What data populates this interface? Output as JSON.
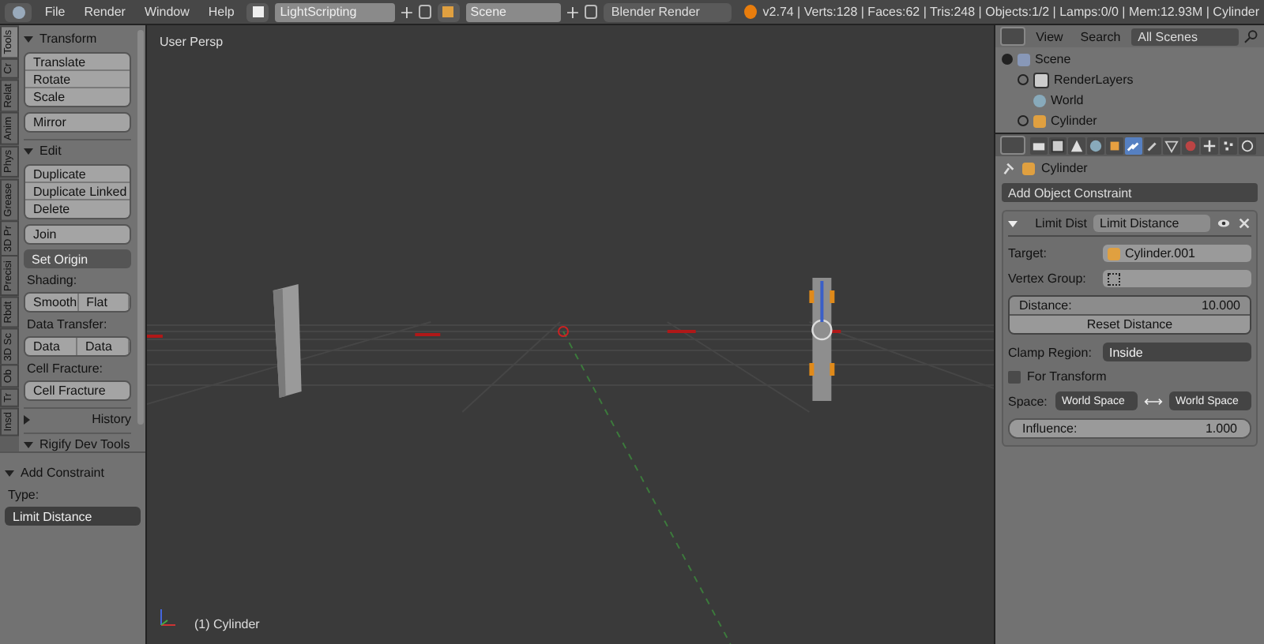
{
  "top_bar": {
    "menus": [
      "File",
      "Render",
      "Window",
      "Help"
    ],
    "layout": "LightScripting",
    "scene": "Scene",
    "engine": "Blender Render",
    "stats": "v2.74 | Verts:128 | Faces:62 | Tris:248 | Objects:1/2 | Lamps:0/0 | Mem:12.93M | Cylinder"
  },
  "tool_tabs": [
    {
      "label": "Tools",
      "selected": true
    },
    {
      "label": "Cr",
      "selected": false
    },
    {
      "label": "Relat",
      "selected": false
    },
    {
      "label": "Anim",
      "selected": false
    },
    {
      "label": "Phys",
      "selected": false
    },
    {
      "label": "Grease",
      "selected": false
    },
    {
      "label": "3D Pr",
      "selected": false
    },
    {
      "label": "Precisi",
      "selected": false
    },
    {
      "label": "Rbdt",
      "selected": false
    },
    {
      "label": "3D Sc",
      "selected": false
    },
    {
      "label": "Ob",
      "selected": false
    },
    {
      "label": "Tr",
      "selected": false
    },
    {
      "label": "Insd",
      "selected": false
    }
  ],
  "tool_shelf": [
    {
      "title": "Transform",
      "expanded": true,
      "items": [
        {
          "kind": "stack",
          "labels": [
            "Translate",
            "Rotate",
            "Scale"
          ]
        },
        {
          "kind": "stack",
          "labels": [
            "Mirror"
          ]
        }
      ]
    },
    {
      "title": "Edit",
      "expanded": true,
      "items": [
        {
          "kind": "stack",
          "labels": [
            "Duplicate",
            "Duplicate Linked",
            "Delete"
          ]
        },
        {
          "kind": "stack",
          "labels": [
            "Join"
          ]
        },
        {
          "kind": "dropdown",
          "label": "Set Origin"
        },
        {
          "kind": "label",
          "label": "Shading:"
        },
        {
          "kind": "row",
          "labels": [
            "Smooth",
            "Flat"
          ]
        },
        {
          "kind": "label",
          "label": "Data Transfer:"
        },
        {
          "kind": "row",
          "labels": [
            "Data",
            "Data"
          ]
        },
        {
          "kind": "label",
          "label": "Cell Fracture:"
        },
        {
          "kind": "stack",
          "labels": [
            "Cell Fracture"
          ]
        }
      ]
    },
    {
      "title": "History",
      "expanded": false
    },
    {
      "title": "Rigify Dev Tools",
      "expanded": true
    }
  ],
  "operator": {
    "title": "Add Constraint",
    "expanded": true,
    "type_label": "Type:",
    "type_value": "Limit Distance"
  },
  "viewport": {
    "view_label": "User Persp",
    "object_label": "(1) Cylinder"
  },
  "outliner": {
    "menus": [
      "View",
      "Search"
    ],
    "filter": "All Scenes",
    "tree": [
      {
        "label": "Scene",
        "kind": "scene",
        "expanded": true,
        "children": [
          {
            "label": "RenderLayers",
            "kind": "layers",
            "expanded": false
          },
          {
            "label": "World",
            "kind": "world"
          },
          {
            "label": "Cylinder",
            "kind": "object",
            "expanded": false
          }
        ]
      }
    ]
  },
  "properties": {
    "tabs": [
      {
        "kind": "render",
        "selected": false
      },
      {
        "kind": "layers",
        "selected": false
      },
      {
        "kind": "scene",
        "selected": false
      },
      {
        "kind": "world",
        "selected": false
      },
      {
        "kind": "object",
        "selected": false
      },
      {
        "kind": "constraints",
        "selected": true
      },
      {
        "kind": "modifiers",
        "selected": false
      },
      {
        "kind": "data",
        "selected": false
      },
      {
        "kind": "material",
        "selected": false
      },
      {
        "kind": "texture",
        "selected": false
      },
      {
        "kind": "particles",
        "selected": false
      },
      {
        "kind": "physics",
        "selected": false
      }
    ],
    "breadcrumb": "Cylinder",
    "add_constraint": "Add Object Constraint",
    "constraint": {
      "expanded": true,
      "type_label": "Limit Dist",
      "name": "Limit Distance",
      "target_label": "Target:",
      "target": "Cylinder.001",
      "vertex_group_label": "Vertex Group:",
      "distance_label": "Distance:",
      "distance": "10.000",
      "reset": "Reset Distance",
      "clamp_label": "Clamp Region:",
      "clamp": "Inside",
      "for_transform": {
        "label": "For Transform",
        "checked": false
      },
      "space_label": "Space:",
      "owner_space": "World Space",
      "target_space": "World Space",
      "influence": {
        "label": "Influence:",
        "reading": "1.000",
        "level": 1
      }
    }
  }
}
